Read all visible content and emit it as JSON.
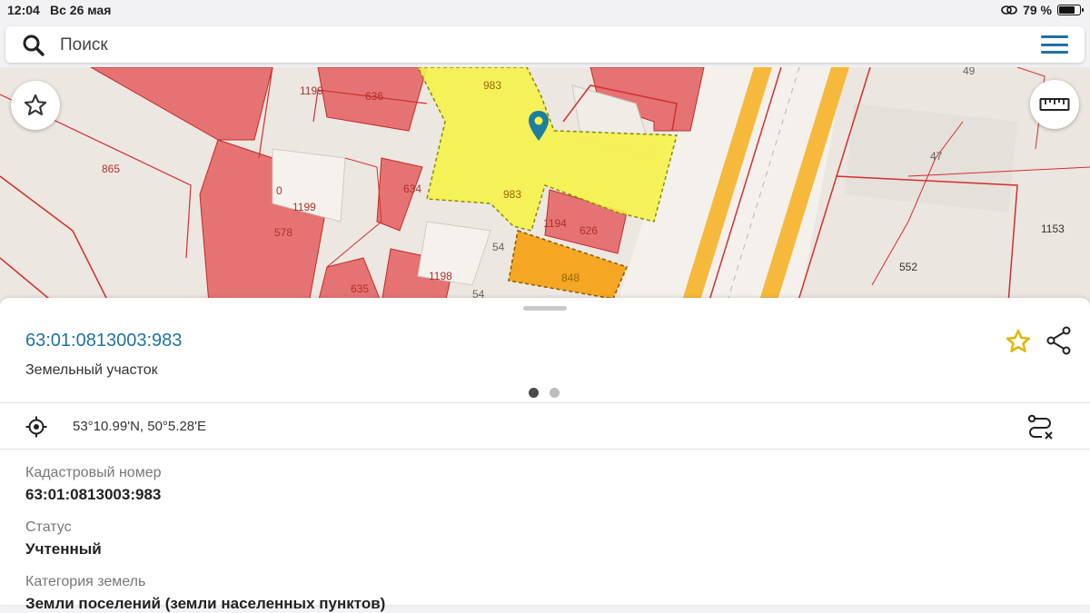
{
  "status_bar": {
    "time": "12:04",
    "date": "Вс 26 мая",
    "battery_percent": "79 %",
    "battery_level": 0.79
  },
  "search": {
    "placeholder": "Поиск",
    "value": ""
  },
  "map": {
    "labels": [
      "1199",
      "636",
      "983",
      "983",
      "865",
      "1199",
      "578",
      "634",
      "1194",
      "626",
      "54",
      "1198",
      "635",
      "54",
      "848",
      "49",
      "47",
      "1153",
      "552",
      "0"
    ]
  },
  "panel": {
    "parcel_id": "63:01:0813003:983",
    "parcel_type": "Земельный участок",
    "page_dots": 2,
    "active_dot": 0,
    "coordinates": "53°10.99'N, 50°5.28'E",
    "fields": [
      {
        "label": "Кадастровый номер",
        "value": "63:01:0813003:983"
      },
      {
        "label": "Статус",
        "value": "Учтенный"
      },
      {
        "label": "Категория земель",
        "value": "Земли поселений (земли населенных пунктов)"
      }
    ]
  },
  "colors": {
    "accent": "#1d73a6",
    "parcel_highlight": "#f6f24a",
    "building": "#e57373",
    "parcel_border": "#d32f2f",
    "road": "#f6b93b",
    "star": "#e6b400"
  }
}
